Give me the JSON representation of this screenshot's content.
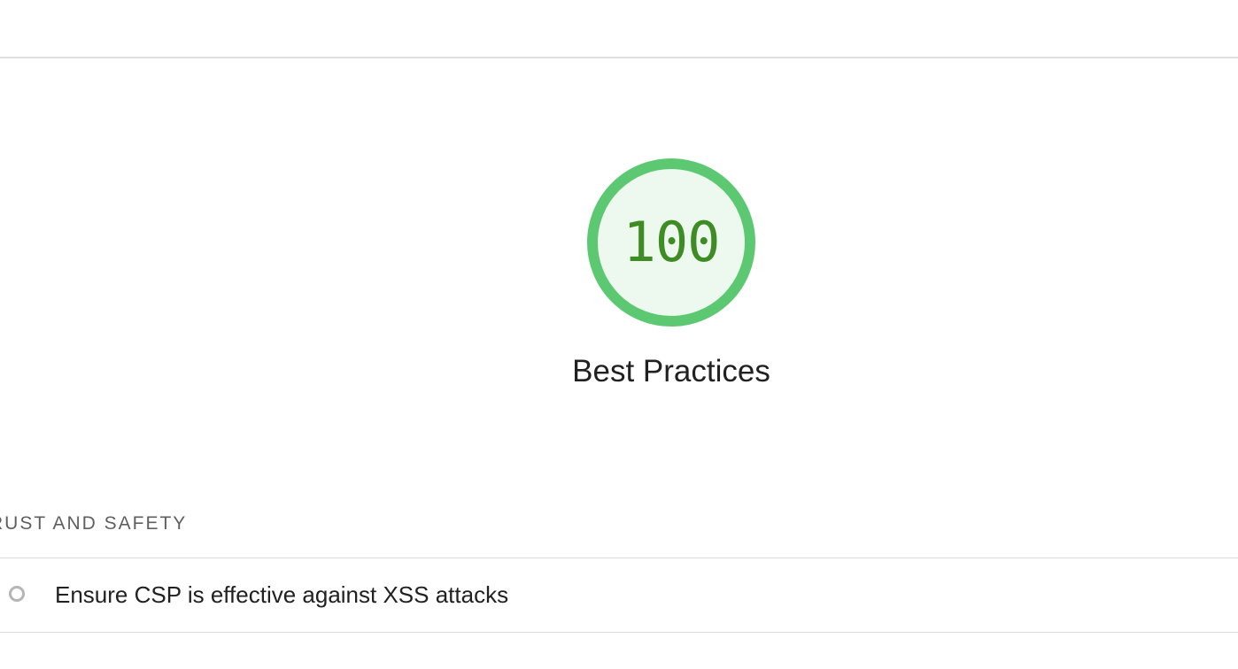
{
  "category": {
    "score": "100",
    "score_fraction": 1.0,
    "label": "Best Practices",
    "colors": {
      "ring": "#5cc972",
      "fill": "#edf8ef",
      "text": "#3e8c24"
    }
  },
  "groups": [
    {
      "title": "RUST AND SAFETY",
      "audits": [
        {
          "title": "Ensure CSP is effective against XSS attacks",
          "status_icon": "informative-circle-icon"
        }
      ]
    }
  ]
}
